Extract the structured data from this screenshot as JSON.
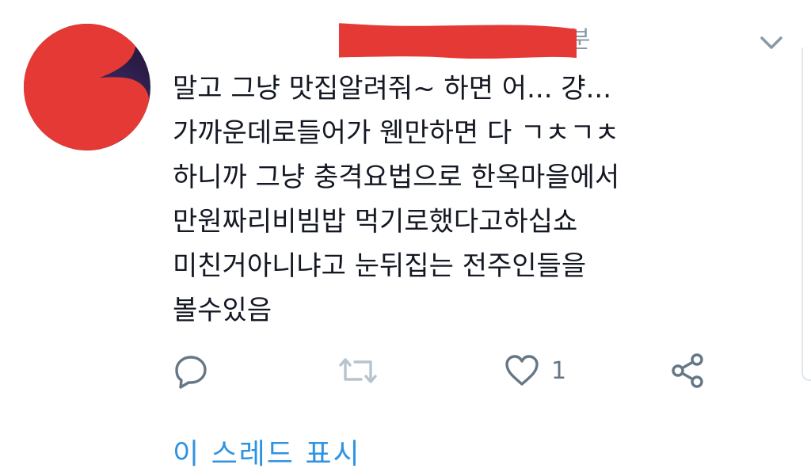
{
  "tweet": {
    "author_name": "",
    "author_handle": "",
    "time": "분",
    "lines": [
      "말고 그냥 맛집알려줘~ 하면 어... 걍...",
      "가까운데로들어가 웬만하면 다 ㄱㅊㄱㅊ",
      "하니까 그냥 충격요법으로 한옥마을에서",
      "만원짜리비빔밥 먹기로했다고하십쇼",
      "미친거아니냐고 눈뒤집는 전주인들을",
      "볼수있음"
    ]
  },
  "actions": {
    "like_count": "1"
  },
  "show_thread_label": "이 스레드 표시",
  "icons": {
    "reply": "reply-icon",
    "retweet": "retweet-icon",
    "like": "heart-icon",
    "share": "share-icon",
    "menu": "chevron-down-icon"
  },
  "colors": {
    "text": "#141823",
    "muted": "#8899a6",
    "link": "#2f93e0",
    "redaction": "#e53935"
  }
}
